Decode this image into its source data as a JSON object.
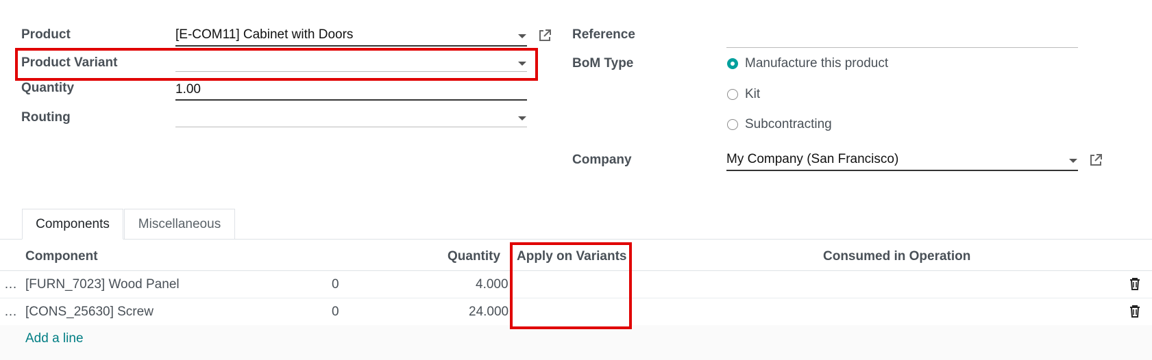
{
  "form": {
    "product": {
      "label": "Product",
      "value": "[E-COM11] Cabinet with Doors"
    },
    "product_variant": {
      "label": "Product Variant",
      "value": ""
    },
    "quantity": {
      "label": "Quantity",
      "value": "1.00"
    },
    "routing": {
      "label": "Routing",
      "value": ""
    },
    "reference": {
      "label": "Reference",
      "value": ""
    },
    "bom_type": {
      "label": "BoM Type",
      "options": [
        "Manufacture this product",
        "Kit",
        "Subcontracting"
      ],
      "selected": "Manufacture this product"
    },
    "company": {
      "label": "Company",
      "value": "My Company (San Francisco)"
    }
  },
  "tabs": [
    {
      "label": "Components",
      "active": true
    },
    {
      "label": "Miscellaneous",
      "active": false
    }
  ],
  "table": {
    "headers": {
      "component": "Component",
      "quantity": "Quantity",
      "apply_on_variants": "Apply on Variants",
      "consumed_in_operation": "Consumed in Operation"
    },
    "rows": [
      {
        "handle": "…",
        "component": "[FURN_7023] Wood Panel",
        "on_hand": "0",
        "quantity": "4.000",
        "apply_on_variants": "",
        "consumed_in_operation": ""
      },
      {
        "handle": "…",
        "component": "[CONS_25630] Screw",
        "on_hand": "0",
        "quantity": "24.000",
        "apply_on_variants": "",
        "consumed_in_operation": ""
      }
    ],
    "add_line": "Add a line"
  },
  "colors": {
    "accent": "#00a09d",
    "link": "#017e84",
    "highlight": "#e00000"
  },
  "icons": [
    "external-link-icon",
    "dropdown-caret-icon",
    "trash-icon",
    "drag-handle-icon",
    "radio-icon"
  ]
}
